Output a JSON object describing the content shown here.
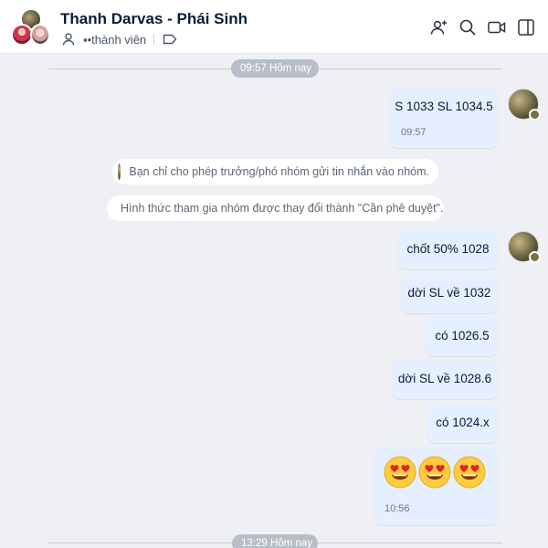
{
  "header": {
    "title": "Thanh Darvas - Phái Sinh",
    "members_label": "▪•thành viên",
    "icons": [
      "add-member-icon",
      "search-icon",
      "video-call-icon",
      "side-panel-icon"
    ]
  },
  "colors": {
    "accent": "#0068ff",
    "my_bubble": "#e5efff",
    "background": "#eef0f3",
    "time_pill": "#b8bec7",
    "pencil_green": "#1fb07a"
  },
  "timeline": {
    "divider_top_label": "09:57 Hôm nay",
    "divider_bottom_label": "13:29 Hôm nay"
  },
  "messages": {
    "m1": {
      "text": "S 1033 SL 1034.5",
      "time": "09:57"
    },
    "m2": {
      "text": "chốt 50% 1028"
    },
    "m3": {
      "text": "dời SL về 1032"
    },
    "m4": {
      "text": "có 1026.5"
    },
    "m5": {
      "text": "dời SL về 1028.6"
    },
    "m6": {
      "text": "có 1024.x"
    },
    "m7": {
      "emoji": "😍😍😍",
      "time": "10:56"
    }
  },
  "notices": {
    "n1": "Bạn chỉ cho phép trưởng/phó nhóm gửi tin nhắn vào nhóm.",
    "n2": "Hình thức tham gia nhóm được thay đổi thành \"Cần phê duyệt\"."
  }
}
